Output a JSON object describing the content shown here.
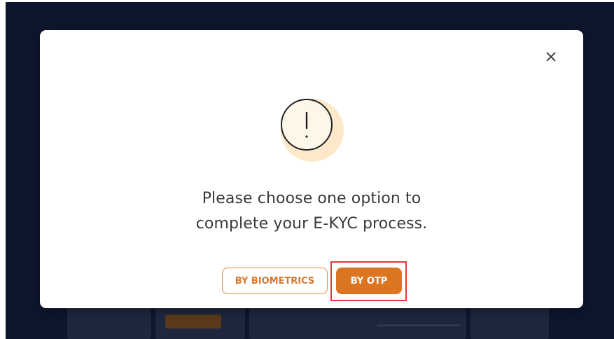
{
  "dialog": {
    "close_symbol": "×",
    "alert_icon": "exclamation-circle-icon",
    "message_line1": "Please choose one option to",
    "message_line2": "complete your E-KYC process.",
    "biometrics_button_label": "BY BIOMETRICS",
    "otp_button_label": "BY OTP"
  },
  "colors": {
    "backdrop": "#101a35",
    "accent_orange": "#db7522",
    "icon_fill": "#fde9c9",
    "highlight_border": "#e53935"
  }
}
